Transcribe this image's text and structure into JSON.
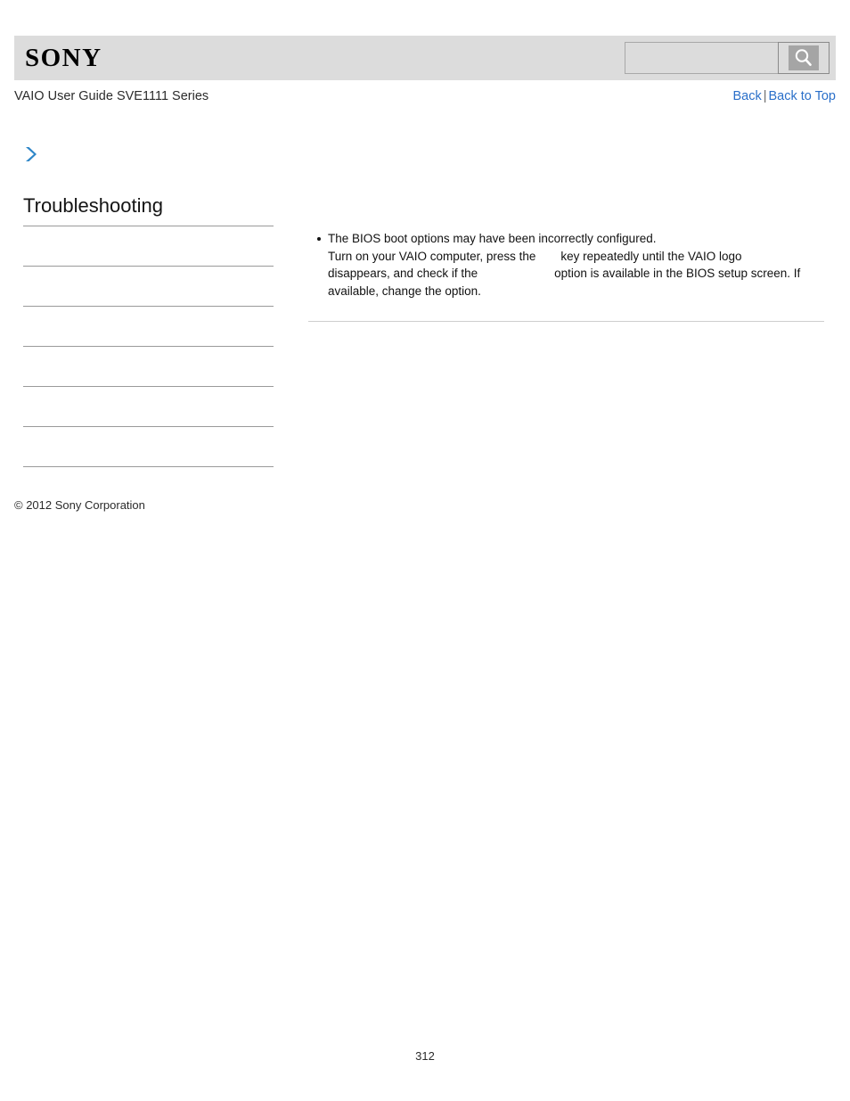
{
  "header": {
    "logo_text": "SONY",
    "search": {
      "value": "",
      "placeholder": "",
      "button_icon": "search-icon"
    }
  },
  "subheader": {
    "guide_title": "VAIO User Guide SVE1111 Series",
    "links": {
      "back": "Back",
      "separator": "|",
      "back_to_top": "Back to Top"
    }
  },
  "breadcrumb_arrow_icon": "chevron-right-icon",
  "sidebar": {
    "heading": "Troubleshooting",
    "items": [
      {
        "label": ""
      },
      {
        "label": ""
      },
      {
        "label": ""
      },
      {
        "label": ""
      },
      {
        "label": ""
      },
      {
        "label": ""
      }
    ]
  },
  "main": {
    "bullets": [
      {
        "line1": "The BIOS boot options may have been incorrectly configured.",
        "line2_a": "Turn on your VAIO computer, press the",
        "line2_b": "key repeatedly until the VAIO logo",
        "line3_a": "disappears, and check if the",
        "line3_b": "option is available in the BIOS setup screen. If",
        "line4": "available, change the option."
      }
    ]
  },
  "footer": {
    "copyright": "© 2012 Sony Corporation",
    "page_number": "312"
  },
  "colors": {
    "header_band": "#dcdcdc",
    "link_blue": "#2a6fc9",
    "chevron_blue": "#2e86c8",
    "rule_gray": "#9a9a9a"
  }
}
